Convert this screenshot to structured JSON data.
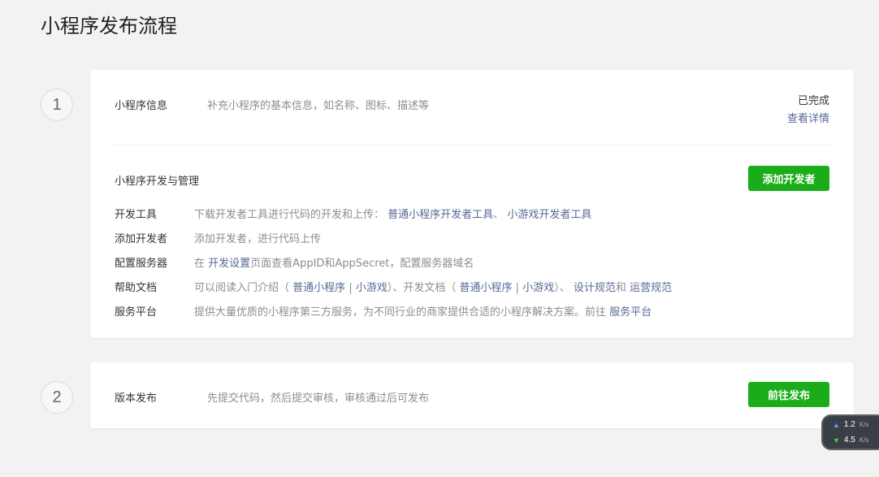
{
  "page": {
    "title": "小程序发布流程"
  },
  "steps": [
    {
      "number": "1"
    },
    {
      "number": "2"
    }
  ],
  "info": {
    "title": "小程序信息",
    "desc": "补充小程序的基本信息，如名称、图标、描述等",
    "status": "已完成",
    "detail_link": "查看详情"
  },
  "dev": {
    "title": "小程序开发与管理",
    "add_button": "添加开发者",
    "rows": {
      "tools": {
        "label": "开发工具",
        "text": "下载开发者工具进行代码的开发和上传：",
        "link1": "普通小程序开发者工具",
        "sep": "、",
        "link2": "小游戏开发者工具"
      },
      "add_dev": {
        "label": "添加开发者",
        "text": "添加开发者，进行代码上传"
      },
      "server": {
        "label": "配置服务器",
        "pre": "在",
        "link": "开发设置",
        "post": "页面查看AppID和AppSecret，配置服务器域名"
      },
      "help": {
        "label": "帮助文档",
        "t1": "可以阅读入门介绍（",
        "l1": "普通小程序",
        "s1": "|",
        "l2": "小游戏",
        "t2": "）、开发文档（",
        "l3": "普通小程序",
        "s2": "|",
        "l4": "小游戏",
        "t3": "）、",
        "l5": "设计规范",
        "t4": "和",
        "l6": "运营规范"
      },
      "service": {
        "label": "服务平台",
        "text": "提供大量优质的小程序第三方服务，为不同行业的商家提供合适的小程序解决方案。前往",
        "link": "服务平台"
      }
    }
  },
  "release": {
    "title": "版本发布",
    "desc": "先提交代码，然后提交审核，审核通过后可发布",
    "button": "前往发布"
  },
  "net": {
    "up": "1.2",
    "down": "4.5",
    "unit": "K/s"
  },
  "colors": {
    "accent_green": "#1aad19",
    "link_blue": "#576b95"
  }
}
